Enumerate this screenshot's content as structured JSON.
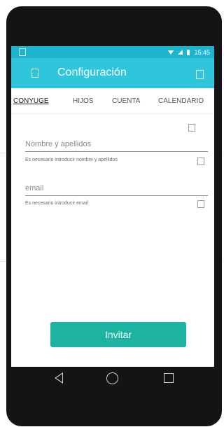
{
  "status_bar": {
    "time": "15:45"
  },
  "app_bar": {
    "title": "Configuración"
  },
  "tabs": [
    "CONYUGE",
    "HIJOS",
    "CUENTA",
    "CALENDARIO"
  ],
  "form": {
    "name_placeholder": "Nombre y apellidos",
    "name_error": "Es necesario introducir nombre y apellidos",
    "email_placeholder": "email",
    "email_error": "Es necesario introducir email"
  },
  "actions": {
    "invite_label": "Invitar"
  },
  "colors": {
    "status_bar": "#1db4cf",
    "app_bar": "#2fc5dc",
    "button": "#1db3a1"
  }
}
